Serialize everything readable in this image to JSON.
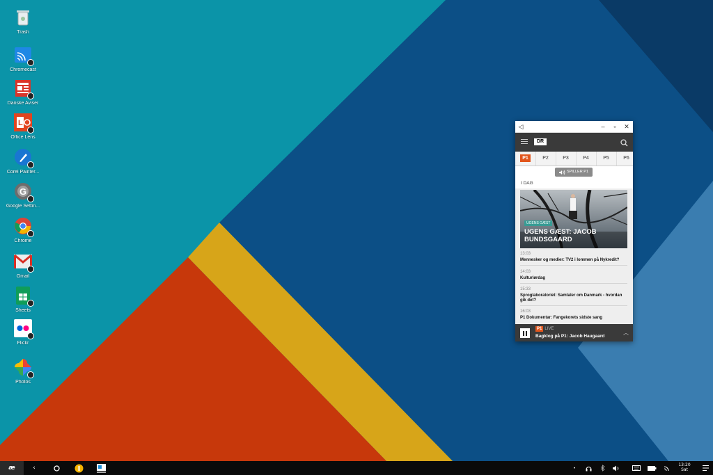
{
  "desktop": {
    "icons": [
      {
        "label": "Trash",
        "icon": "trash-icon"
      },
      {
        "label": "Chromecast",
        "icon": "chromecast-icon"
      },
      {
        "label": "Danske Aviser",
        "icon": "newspaper-icon"
      },
      {
        "label": "Office Lens",
        "icon": "office-lens-icon"
      },
      {
        "label": "Corel Painter...",
        "icon": "corel-painter-icon"
      },
      {
        "label": "Google Settin...",
        "icon": "google-settings-icon"
      },
      {
        "label": "Chrome",
        "icon": "chrome-icon"
      },
      {
        "label": "Gmail",
        "icon": "gmail-icon"
      },
      {
        "label": "Sheets",
        "icon": "sheets-icon"
      },
      {
        "label": "Flickr",
        "icon": "flickr-icon"
      },
      {
        "label": "Photos",
        "icon": "photos-icon"
      }
    ]
  },
  "app": {
    "logo": "DR",
    "tabs": [
      "P1",
      "P2",
      "P3",
      "P4",
      "P5",
      "P6"
    ],
    "active_tab": "P1",
    "playing_label": "SPILLER P1",
    "section": "I DAG",
    "hero": {
      "tag": "UGENS GÆST",
      "title": "UGENS GÆST: JACOB BUNDSGAARD"
    },
    "programs": [
      {
        "time": "13:03",
        "name": "Mennesker og medier: TV2 i lommen på Nykredit?"
      },
      {
        "time": "14:03",
        "name": "Kulturlørdag"
      },
      {
        "time": "15:33",
        "name": "Sproglaboratoriet: Samtaler om Danmark - hvordan gik det?"
      },
      {
        "time": "16:03",
        "name": "P1 Dokumentar: Fangekorets sidste sang"
      }
    ],
    "player": {
      "channel": "P1",
      "live": "LIVE",
      "title": "Bagklog på P1: Jacob Haugaard"
    }
  },
  "taskbar": {
    "launcher": "æ",
    "clock_time": "13:20",
    "clock_day": "Sat"
  },
  "colors": {
    "teal": "#0b94a8",
    "navy": "#0c4f86",
    "orange": "#c7380b",
    "yellow": "#d7a519",
    "dr_orange": "#e2561d"
  }
}
